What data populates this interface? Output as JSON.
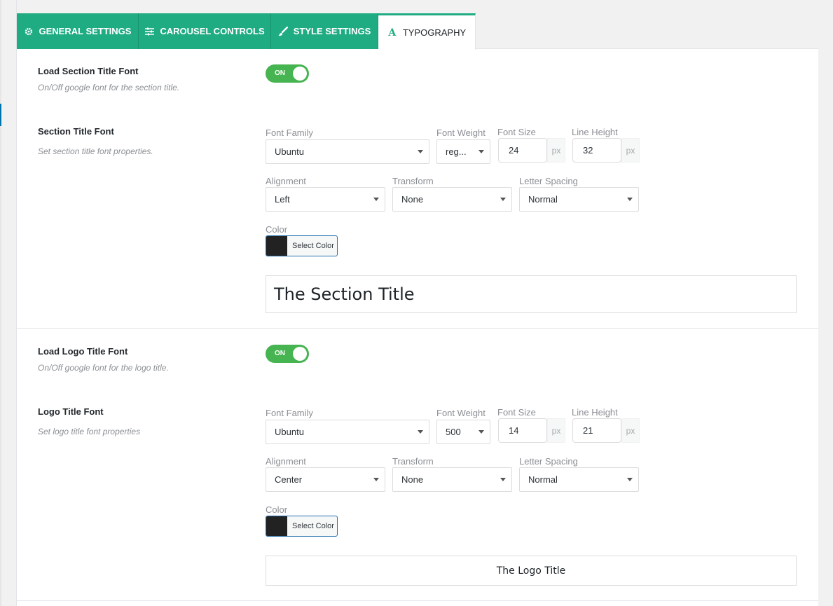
{
  "tabs": [
    {
      "label": "GENERAL SETTINGS",
      "icon": "gear-icon"
    },
    {
      "label": "CAROUSEL CONTROLS",
      "icon": "sliders-icon"
    },
    {
      "label": "STYLE SETTINGS",
      "icon": "brush-icon"
    },
    {
      "label": "TYPOGRAPHY",
      "icon": "font-icon",
      "active": true
    }
  ],
  "section_title": {
    "load_label": "Load Section Title Font",
    "load_desc": "On/Off google font for the section title.",
    "toggle": "ON",
    "font_label": "Section Title Font",
    "font_desc": "Set section title font properties.",
    "font_family_label": "Font Family",
    "font_family": "Ubuntu",
    "font_weight_label": "Font Weight",
    "font_weight": "reg...",
    "font_size_label": "Font Size",
    "font_size": "24",
    "font_size_unit": "px",
    "line_height_label": "Line Height",
    "line_height": "32",
    "line_height_unit": "px",
    "alignment_label": "Alignment",
    "alignment": "Left",
    "transform_label": "Transform",
    "transform": "None",
    "letter_spacing_label": "Letter Spacing",
    "letter_spacing": "Normal",
    "color_label": "Color",
    "color_button": "Select Color",
    "color_value": "#222222",
    "preview": "The Section Title"
  },
  "logo_title": {
    "load_label": "Load Logo Title Font",
    "load_desc": "On/Off google font for the logo title.",
    "toggle": "ON",
    "font_label": "Logo Title Font",
    "font_desc": "Set logo title font properties",
    "font_family_label": "Font Family",
    "font_family": "Ubuntu",
    "font_weight_label": "Font Weight",
    "font_weight": "500",
    "font_size_label": "Font Size",
    "font_size": "14",
    "font_size_unit": "px",
    "line_height_label": "Line Height",
    "line_height": "21",
    "line_height_unit": "px",
    "alignment_label": "Alignment",
    "alignment": "Center",
    "transform_label": "Transform",
    "transform": "None",
    "letter_spacing_label": "Letter Spacing",
    "letter_spacing": "Normal",
    "color_label": "Color",
    "color_button": "Select Color",
    "color_value": "#222222",
    "preview": "The Logo Title"
  },
  "colors": {
    "accent": "#1fac83",
    "toggle_on": "#46b450",
    "focus_border": "#2271b1"
  }
}
